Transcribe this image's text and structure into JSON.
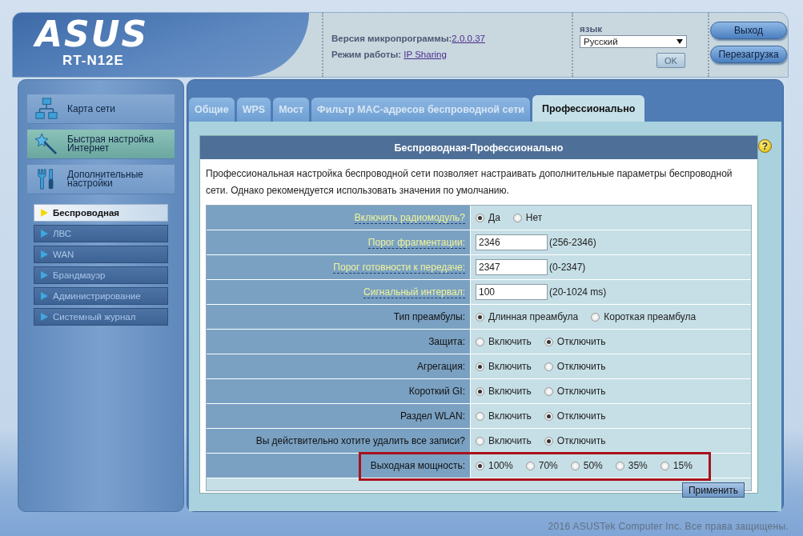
{
  "header": {
    "logo": "ASUS",
    "model": "RT-N12E",
    "firmware_label": "Версия микропрограммы:",
    "firmware_value": "2.0.0.37",
    "mode_label": "Режим работы:",
    "mode_value": "IP Sharing",
    "language_label": "язык",
    "language_value": "Русский",
    "ok_button": {
      "label": "OK",
      "disabled": true
    },
    "buttons": [
      "Выход",
      "Перезагрузка"
    ]
  },
  "sidebar": {
    "menu": [
      {
        "kind": "network",
        "label": "Карта сети",
        "highlighted": false
      },
      {
        "kind": "wizard",
        "label": "Быстрая настройка Интернет",
        "highlighted": true
      },
      {
        "kind": "tools",
        "label": "Дополнительные настройки",
        "highlighted": false
      }
    ],
    "submenu": [
      {
        "label": "Беспроводная",
        "selected": true
      },
      {
        "label": "ЛВС",
        "selected": false
      },
      {
        "label": "WAN",
        "selected": false
      },
      {
        "label": "Брандмауэр",
        "selected": false
      },
      {
        "label": "Администрирование",
        "selected": false
      },
      {
        "label": "Системный журнал",
        "selected": false
      }
    ]
  },
  "tabs": [
    {
      "label": "Общие",
      "selected": false
    },
    {
      "label": "WPS",
      "selected": false
    },
    {
      "label": "Мост",
      "selected": false
    },
    {
      "label": "Фильтр MAC-адресов беспроводной сети",
      "selected": false
    },
    {
      "label": "Профессионально",
      "selected": true
    }
  ],
  "help": "?",
  "section_title": "Беспроводная-Профессионально",
  "description": "Профессиональная настройка беспроводной сети позволяет настраивать дополнительные параметры беспроводной сети. Однако рекомендуется использовать значения по умолчанию.",
  "rows": [
    {
      "kind": "radio",
      "label": "Включить радиомодуль?",
      "link": true,
      "highlighted": false,
      "options": [
        {
          "label": "Да",
          "selected": true
        },
        {
          "label": "Нет",
          "selected": false
        }
      ]
    },
    {
      "kind": "input",
      "label": "Порог фрагментации:",
      "link": true,
      "highlighted": false,
      "value": "2346",
      "hint": "(256-2346)"
    },
    {
      "kind": "input",
      "label": "Порог готовности к передаче:",
      "link": true,
      "highlighted": false,
      "value": "2347",
      "hint": "(0-2347)"
    },
    {
      "kind": "input",
      "label": "Сигнальный интервал:",
      "link": true,
      "highlighted": false,
      "value": "100",
      "hint": "(20-1024 ms)"
    },
    {
      "kind": "radio",
      "label": "Тип преамбулы:",
      "link": false,
      "highlighted": false,
      "options": [
        {
          "label": "Длинная преамбула",
          "selected": true
        },
        {
          "label": "Короткая преамбула",
          "selected": false
        }
      ]
    },
    {
      "kind": "radio",
      "label": "Защита:",
      "link": false,
      "highlighted": false,
      "options": [
        {
          "label": "Включить",
          "selected": false
        },
        {
          "label": "Отключить",
          "selected": true
        }
      ]
    },
    {
      "kind": "radio",
      "label": "Агрегация:",
      "link": false,
      "highlighted": false,
      "options": [
        {
          "label": "Включить",
          "selected": true
        },
        {
          "label": "Отключить",
          "selected": false
        }
      ]
    },
    {
      "kind": "radio",
      "label": "Короткий GI:",
      "link": false,
      "highlighted": false,
      "options": [
        {
          "label": "Включить",
          "selected": true
        },
        {
          "label": "Отключить",
          "selected": false
        }
      ]
    },
    {
      "kind": "radio",
      "label": "Раздел WLAN:",
      "link": false,
      "highlighted": false,
      "options": [
        {
          "label": "Включить",
          "selected": false
        },
        {
          "label": "Отключить",
          "selected": true
        }
      ]
    },
    {
      "kind": "radio",
      "label": "Вы действительно хотите удалить все записи?",
      "link": false,
      "highlighted": false,
      "options": [
        {
          "label": "Включить",
          "selected": false
        },
        {
          "label": "Отключить",
          "selected": true
        }
      ]
    },
    {
      "kind": "radio",
      "label": "Выходная мощность:",
      "link": false,
      "highlighted": true,
      "options": [
        {
          "label": "100%",
          "selected": true
        },
        {
          "label": "70%",
          "selected": false
        },
        {
          "label": "50%",
          "selected": false
        },
        {
          "label": "35%",
          "selected": false
        },
        {
          "label": "15%",
          "selected": false
        }
      ]
    }
  ],
  "apply_button": "Применить",
  "footer": "2016 ASUSTek Computer Inc. Все права защищены."
}
